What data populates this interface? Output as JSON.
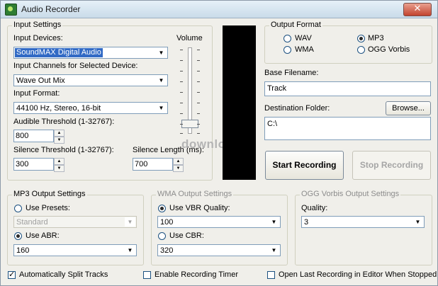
{
  "window": {
    "title": "Audio Recorder",
    "close_glyph": "✕",
    "app_icon": "recorder-icon"
  },
  "input_settings": {
    "legend": "Input Settings",
    "devices_label": "Input Devices:",
    "device_value": "SoundMAX Digital Audio",
    "channels_label": "Input Channels for Selected Device:",
    "channel_value": "Wave Out Mix",
    "format_label": "Input Format:",
    "format_value": "44100 Hz, Stereo, 16-bit",
    "audible_label": "Audible Threshold (1-32767):",
    "audible_value": "800",
    "silence_label": "Silence Threshold (1-32767):",
    "silence_value": "300",
    "silence_length_label": "Silence Length (ms):",
    "silence_length_value": "700",
    "volume_label": "Volume"
  },
  "output_format": {
    "legend": "Output Format",
    "options": [
      "WAV",
      "MP3",
      "WMA",
      "OGG Vorbis"
    ],
    "selected": "MP3"
  },
  "output": {
    "base_filename_label": "Base Filename:",
    "base_filename_value": "Track",
    "destination_label": "Destination Folder:",
    "destination_value": "C:\\",
    "browse_label": "Browse...",
    "start_label": "Start Recording",
    "stop_label": "Stop Recording"
  },
  "mp3_settings": {
    "legend": "MP3 Output Settings",
    "use_presets_label": "Use Presets:",
    "preset_value": "Standard",
    "use_abr_label": "Use ABR:",
    "abr_value": "160"
  },
  "wma_settings": {
    "legend": "WMA Output Settings",
    "vbr_label": "Use VBR Quality:",
    "vbr_value": "100",
    "cbr_label": "Use CBR:",
    "cbr_value": "320"
  },
  "ogg_settings": {
    "legend": "OGG Vorbis Output Settings",
    "quality_label": "Quality:",
    "quality_value": "3"
  },
  "options": {
    "auto_split_label": "Automatically Split Tracks",
    "auto_split_checked": true,
    "timer_label": "Enable Recording Timer",
    "timer_checked": false,
    "open_last_label": "Open Last Recording in Editor When Stopped",
    "open_last_checked": false
  },
  "watermark": "download"
}
